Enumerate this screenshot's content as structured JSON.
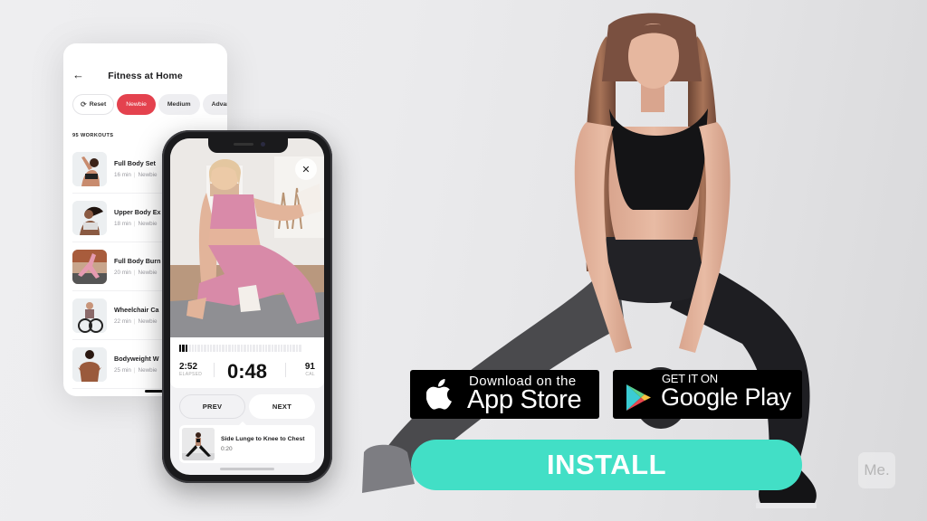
{
  "back_screen": {
    "title": "Fitness at Home",
    "back_icon": "arrow-left",
    "filters": [
      {
        "label": "Reset",
        "icon": "refresh",
        "active": false
      },
      {
        "label": "Newbie",
        "active": true
      },
      {
        "label": "Medium",
        "active": false
      },
      {
        "label": "Advance",
        "active": false
      }
    ],
    "workout_count": "95 WORKOUTS",
    "workouts": [
      {
        "name": "Full Body Set",
        "duration": "16 min",
        "level": "Newbie"
      },
      {
        "name": "Upper Body Ex",
        "duration": "18 min",
        "level": "Newbie"
      },
      {
        "name": "Full Body Burn",
        "duration": "20 min",
        "level": "Newbie"
      },
      {
        "name": "Wheelchair Ca",
        "duration": "22 min",
        "level": "Newbie"
      },
      {
        "name": "Bodyweight W",
        "duration": "25 min",
        "level": "Newbie"
      }
    ]
  },
  "player": {
    "close_icon": "x",
    "progress": {
      "completed_segments": 3,
      "total_segments": 40
    },
    "elapsed_value": "2:52",
    "elapsed_label": "ELAPSED",
    "timer": "0:48",
    "calories_value": "91",
    "calories_label": "CAL",
    "prev_label": "PREV",
    "next_label": "NEXT",
    "next_exercise": {
      "title": "Side Lunge to Knee to Chest",
      "duration": "0:20"
    }
  },
  "store_badges": {
    "apple": {
      "small": "Download on the",
      "big": "App Store"
    },
    "google": {
      "small": "GET IT ON",
      "big": "Google Play"
    }
  },
  "install_label": "INSTALL",
  "brand_logo": "Me.",
  "colors": {
    "accent_red": "#e4424e",
    "install_teal": "#42dfc6",
    "badge_black": "#000000"
  }
}
